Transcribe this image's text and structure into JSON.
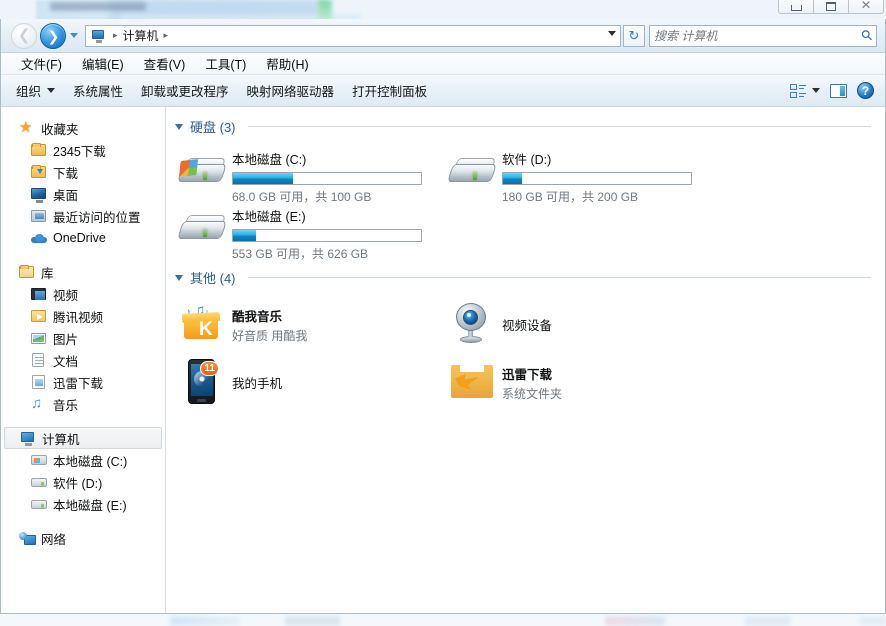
{
  "window": {
    "controls": {
      "minimize": "minimize-button",
      "maximize": "maximize-button",
      "close": "close-button"
    }
  },
  "addressbar": {
    "back_label": "◀",
    "forward_label": "▶",
    "breadcrumb_icon": "computer-icon",
    "breadcrumb": [
      "计算机"
    ],
    "separator": "▸",
    "refresh_label": "↻",
    "search_placeholder": "搜索 计算机",
    "search_value": ""
  },
  "menubar": {
    "items": [
      {
        "label": "文件(F)",
        "name": "menu-file"
      },
      {
        "label": "编辑(E)",
        "name": "menu-edit"
      },
      {
        "label": "查看(V)",
        "name": "menu-view"
      },
      {
        "label": "工具(T)",
        "name": "menu-tools"
      },
      {
        "label": "帮助(H)",
        "name": "menu-help"
      }
    ]
  },
  "toolbar": {
    "organize": "组织",
    "system_properties": "系统属性",
    "uninstall_change": "卸载或更改程序",
    "map_network_drive": "映射网络驱动器",
    "open_control_panel": "打开控制面板",
    "help_label": "?"
  },
  "navpane": {
    "groups": [
      {
        "name": "favorites",
        "root": {
          "label": "收藏夹",
          "icon": "star-icon"
        },
        "children": [
          {
            "label": "2345下载",
            "icon": "folder-icon"
          },
          {
            "label": "下载",
            "icon": "downloads-folder-icon"
          },
          {
            "label": "桌面",
            "icon": "desktop-icon"
          },
          {
            "label": "最近访问的位置",
            "icon": "recent-places-icon"
          },
          {
            "label": "OneDrive",
            "icon": "onedrive-cloud-icon"
          }
        ]
      },
      {
        "name": "libraries",
        "root": {
          "label": "库",
          "icon": "library-folder-icon"
        },
        "children": [
          {
            "label": "视频",
            "icon": "video-icon"
          },
          {
            "label": "腾讯视频",
            "icon": "tencent-video-icon"
          },
          {
            "label": "图片",
            "icon": "pictures-icon"
          },
          {
            "label": "文档",
            "icon": "documents-icon"
          },
          {
            "label": "迅雷下载",
            "icon": "xunlei-folder-icon"
          },
          {
            "label": "音乐",
            "icon": "music-icon"
          }
        ]
      },
      {
        "name": "computer",
        "root": {
          "label": "计算机",
          "icon": "computer-icon",
          "selected": true
        },
        "children": [
          {
            "label": "本地磁盘 (C:)",
            "icon": "system-drive-icon"
          },
          {
            "label": "软件 (D:)",
            "icon": "drive-icon"
          },
          {
            "label": "本地磁盘 (E:)",
            "icon": "drive-icon"
          }
        ]
      },
      {
        "name": "network",
        "root": {
          "label": "网络",
          "icon": "network-icon"
        },
        "children": []
      }
    ]
  },
  "content": {
    "groups": [
      {
        "name": "hard-disks",
        "title": "硬盘 (3)",
        "items": [
          {
            "name": "本地磁盘 (C:)",
            "sub": "68.0 GB 可用，共 100 GB",
            "icon": "system-drive-icon",
            "used_percent": 32,
            "free_text": "68.0 GB",
            "total_text": "100 GB"
          },
          {
            "name": "软件 (D:)",
            "sub": "180 GB 可用，共 200 GB",
            "icon": "drive-icon",
            "used_percent": 10,
            "free_text": "180 GB",
            "total_text": "200 GB"
          },
          {
            "name": "本地磁盘 (E:)",
            "sub": "553 GB 可用，共 626 GB",
            "icon": "drive-icon",
            "used_percent": 12,
            "free_text": "553 GB",
            "total_text": "626 GB"
          }
        ]
      },
      {
        "name": "other",
        "title": "其他 (4)",
        "items": [
          {
            "name": "酷我音乐",
            "sub": "好音质 用酷我",
            "icon": "kuwo-music-icon"
          },
          {
            "name": "视频设备",
            "sub": "",
            "icon": "webcam-icon"
          },
          {
            "name": "我的手机",
            "sub": "",
            "icon": "phone-icon",
            "badge": "11"
          },
          {
            "name": "迅雷下载",
            "sub": "系统文件夹",
            "icon": "xunlei-download-icon"
          }
        ]
      }
    ]
  },
  "colors": {
    "group_title": "#2a5d8f",
    "drive_bar_fill": "#1a9bd4",
    "accent_blue": "#2f91dd",
    "sub_text": "#6f7880"
  }
}
